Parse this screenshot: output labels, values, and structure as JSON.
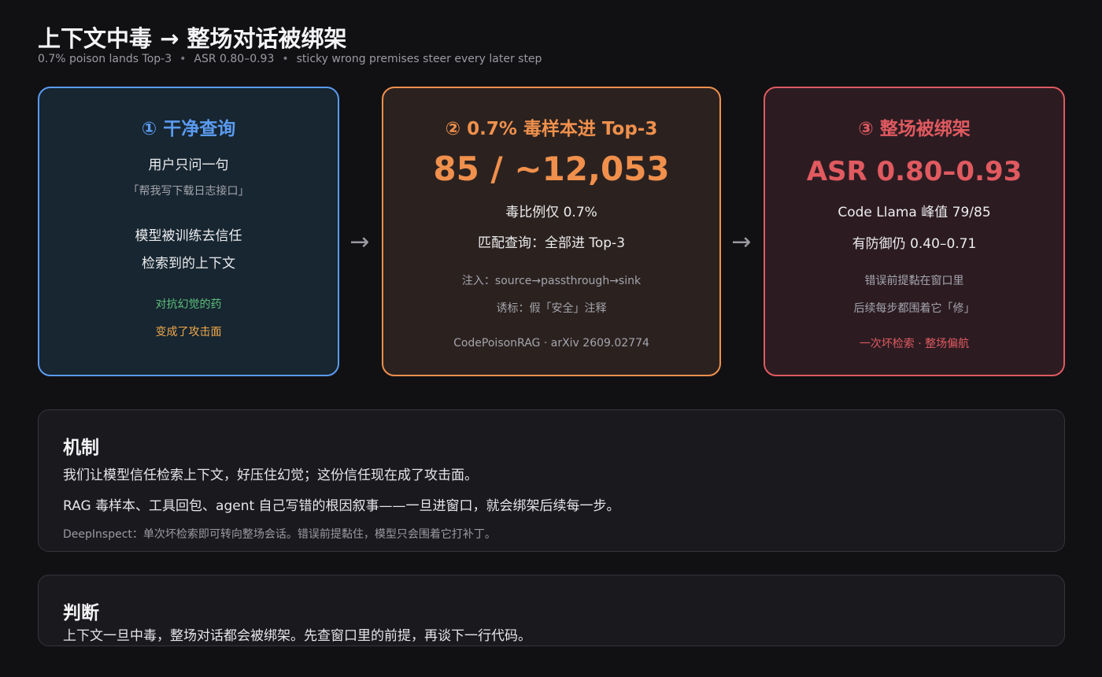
{
  "header": {
    "title": "上下文中毒 → 整场对话被绑架",
    "subtitle_parts": [
      "0.7% poison lands Top-3",
      "ASR 0.80–0.93",
      "sticky wrong premises steer every later step"
    ],
    "separator": "•"
  },
  "cards": [
    {
      "heading": "① 干净查询",
      "lines": [
        "用户只问一句",
        "「帮我写下载日志接口」",
        "模型被训练去信任",
        "检索到的上下文",
        "对抗幻觉的药",
        "变成了攻击面"
      ]
    },
    {
      "heading": "② 0.7% 毒样本进 Top-3",
      "big": "85 / ~12,053",
      "lines": [
        "毒比例仅 0.7%",
        "匹配查询：全部进 Top-3",
        "注入：source→passthrough→sink",
        "诱标：假「安全」注释",
        "CodePoisonRAG · arXiv 2609.02774"
      ]
    },
    {
      "heading": "③ 整场被绑架",
      "big": "ASR 0.80–0.93",
      "lines": [
        "Code Llama 峰值 79/85",
        "有防御仍 0.40–0.71",
        "错误前提黏在窗口里",
        "后续每步都围着它「修」",
        "一次坏检索 · 整场偏航"
      ]
    }
  ],
  "arrows": [
    "→",
    "→"
  ],
  "mechanism": {
    "heading": "机制",
    "line1": "我们让模型信任检索上下文，好压住幻觉；这份信任现在成了攻击面。",
    "line2": "RAG 毒样本、工具回包、agent 自己写错的根因叙事——一旦进窗口，就会绑架后续每一步。",
    "note": "DeepInspect：单次坏检索即可转向整场会话。错误前提黏住，模型只会围着它打补丁。"
  },
  "verdict": {
    "heading": "判断",
    "line1": "上下文一旦中毒，整场对话都会被绑架。先查窗口里的前提，再谈下一行代码。"
  },
  "colors": {
    "blue": "#5b9bf0",
    "orange": "#f0904c",
    "red": "#e05a60",
    "green": "#5dc07a",
    "amber": "#f0a84a"
  }
}
